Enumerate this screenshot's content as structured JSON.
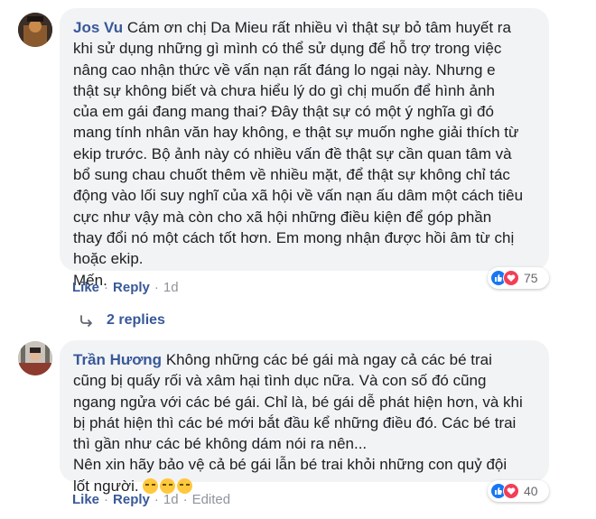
{
  "comments": [
    {
      "author": "Jos Vu",
      "body": "Cám ơn chị Da Mieu rất nhiều vì thật sự bỏ tâm huyết ra\nkhi sử dụng những gì mình có thể sử dụng để hỗ trợ trong việc\nnâng cao nhận thức về vấn nạn rất đáng lo ngại này. Nhưng e\nthật sự không biết và chưa hiểu lý do gì chị muốn để hình ảnh\ncủa em gái đang mang thai? Đây thật sự có một ý nghĩa gì đó\nmang tính nhân văn hay không, e thật sự muốn nghe giải thích từ\nekip trước. Bộ ảnh này có nhiều vấn đề thật sự cần quan tâm và\nbổ sung chau chuốt thêm về nhiều mặt, để thật sự không chỉ tác\nđộng vào lối suy nghĩ của xã hội về vấn nạn ấu dâm một cách tiêu\ncực như vậy mà còn cho xã hội những điều kiện để góp phần\nthay đổi nó một cách tốt hơn. Em mong nhận được hồi âm từ chị\nhoặc ekip.\nMến.",
      "reaction_count": "75",
      "like_label": "Like",
      "reply_label": "Reply",
      "time": "1d",
      "edited": ""
    },
    {
      "author": "Trần Hương",
      "body": "Không những các bé gái mà ngay cả các bé trai\ncũng bị quấy rối và xâm hại tình dục nữa. Và con số đó cũng\nngang ngửa với các bé gái. Chỉ là, bé gái dễ phát hiện hơn, và khi\nbị phát hiện thì các bé mới bắt đầu kể những điều đó. Các bé trai\nthì gần như các bé không dám nói ra nên...\nNên xin hãy bảo vệ cả bé gái lẫn bé trai khỏi những con quỷ đội\nlốt người.",
      "reaction_count": "40",
      "like_label": "Like",
      "reply_label": "Reply",
      "time": "1d",
      "edited": "Edited"
    }
  ],
  "replies_label": "2 replies",
  "separator": "·",
  "colors": {
    "link": "#385898",
    "bubble": "#f2f3f5",
    "like": "#1877f2",
    "love": "#f33e58"
  },
  "icons": {
    "reply_arrow": "reply-arrow-icon",
    "like_reaction": "like-reaction-icon",
    "love_reaction": "love-reaction-icon",
    "emoji": "persevering-face-emoji"
  }
}
